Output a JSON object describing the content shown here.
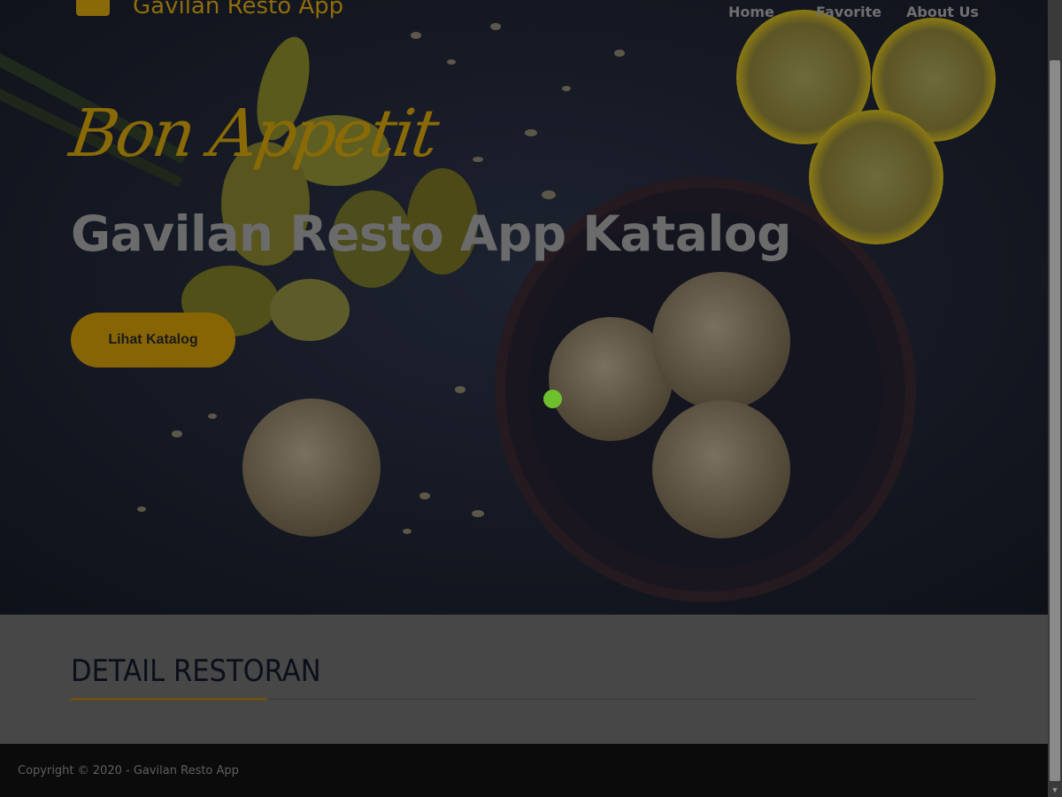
{
  "navbar": {
    "brand_name": "Gavilan Resto App",
    "brand_icon": "restaurant-logo-icon",
    "links": [
      {
        "label": "Home"
      },
      {
        "label": "Favorite"
      },
      {
        "label": "About Us"
      }
    ]
  },
  "hero": {
    "tagline": "Bon Appetit",
    "title": "Gavilan Resto App Katalog",
    "cta_label": "Lihat Katalog",
    "background": "dark food photo: cookies in a bowl, lemon slices, yellow daffodils"
  },
  "detail": {
    "heading": "DETAIL RESTORAN"
  },
  "footer": {
    "copyright": "Copyright © 2020 - Gavilan Resto App"
  },
  "scrollbar": {
    "down_arrow": "▼"
  },
  "colors": {
    "accent": "#876505",
    "hero_overlay": "#141820",
    "section_bg": "#474747",
    "footer_bg": "#0b0b0b",
    "cursor": "#6fc02e"
  }
}
